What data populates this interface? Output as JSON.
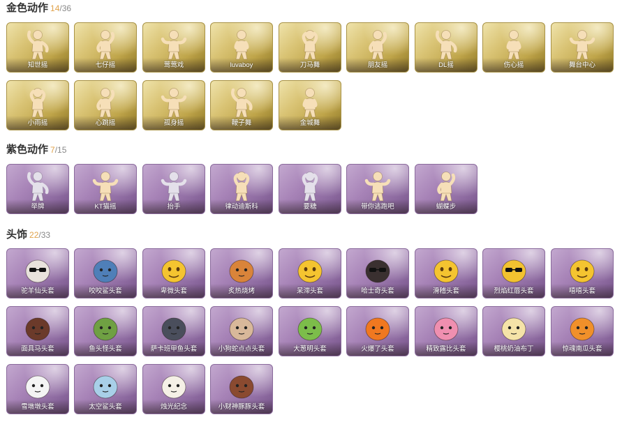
{
  "sections": [
    {
      "title": "金色动作",
      "count": "14",
      "total": "/36",
      "rarity": "gold",
      "items": [
        {
          "label": "知世摇",
          "icon": "dance-pose-icon"
        },
        {
          "label": "七仔摇",
          "icon": "dance-pose-icon"
        },
        {
          "label": "莺莺戏",
          "icon": "dance-pose-icon"
        },
        {
          "label": "luvaboy",
          "icon": "dance-pose-icon"
        },
        {
          "label": "刀马舞",
          "icon": "dance-pose-icon"
        },
        {
          "label": "朋友摇",
          "icon": "dance-pose-icon"
        },
        {
          "label": "DL摇",
          "icon": "dance-pose-icon"
        },
        {
          "label": "伤心摇",
          "icon": "dance-pose-icon"
        },
        {
          "label": "舞台中心",
          "icon": "dance-pose-icon"
        },
        {
          "label": "小雨摇",
          "icon": "dance-pose-icon"
        },
        {
          "label": "心跳摇",
          "icon": "dance-pose-icon"
        },
        {
          "label": "孤身摇",
          "icon": "dance-pose-icon"
        },
        {
          "label": "鞭子舞",
          "icon": "dance-pose-icon"
        },
        {
          "label": "金城舞",
          "icon": "dance-pose-icon"
        }
      ]
    },
    {
      "title": "紫色动作",
      "count": "7",
      "total": "/15",
      "rarity": "purple",
      "items": [
        {
          "label": "举牌",
          "icon": "holding-sign-icon"
        },
        {
          "label": "KT猫摇",
          "icon": "dance-pose-icon"
        },
        {
          "label": "抬手",
          "icon": "raise-hand-icon"
        },
        {
          "label": "律动迪斯科",
          "icon": "dance-pose-icon"
        },
        {
          "label": "要糖",
          "icon": "standing-pose-icon"
        },
        {
          "label": "带你逃跑吧",
          "icon": "dance-pose-icon"
        },
        {
          "label": "蝴蝶步",
          "icon": "dance-pose-icon"
        }
      ]
    },
    {
      "title": "头饰",
      "count": "22",
      "total": "/33",
      "rarity": "purple",
      "items": [
        {
          "label": "驼羊仙头套",
          "icon": "sunglasses-bear-head-icon",
          "color": "#e8e2dc"
        },
        {
          "label": "咬咬鲨头套",
          "icon": "shark-head-icon",
          "color": "#4f7fb8"
        },
        {
          "label": "卑微头套",
          "icon": "shy-emoji-head-icon",
          "color": "#f4c430"
        },
        {
          "label": "炙热烧烤",
          "icon": "toast-head-icon",
          "color": "#d9843a"
        },
        {
          "label": "呆滞头套",
          "icon": "dazed-emoji-head-icon",
          "color": "#f4c430"
        },
        {
          "label": "哈士奇头套",
          "icon": "husky-head-icon",
          "color": "#3a3030"
        },
        {
          "label": "滑稽头套",
          "icon": "grin-emoji-head-icon",
          "color": "#f4c430"
        },
        {
          "label": "烈焰红唇头套",
          "icon": "pikachu-head-icon",
          "color": "#f2c230"
        },
        {
          "label": "嘻嘻头套",
          "icon": "grin-teeth-emoji-head-icon",
          "color": "#f4c430"
        },
        {
          "label": "面具马头套",
          "icon": "horse-head-icon",
          "color": "#6b3a2a"
        },
        {
          "label": "鱼头怪头套",
          "icon": "fish-monster-head-icon",
          "color": "#6fa043"
        },
        {
          "label": "萨卡班甲鱼头套",
          "icon": "fish-head-icon",
          "color": "#4a4e5c"
        },
        {
          "label": "小狗蛇点点头套",
          "icon": "snake-head-icon",
          "color": "#d8b89a"
        },
        {
          "label": "大葱明头套",
          "icon": "scallion-head-icon",
          "color": "#7cbd4a"
        },
        {
          "label": "火爆了头套",
          "icon": "fire-head-icon",
          "color": "#f07820"
        },
        {
          "label": "精致露比头套",
          "icon": "pink-pig-head-icon",
          "color": "#ef8fb0"
        },
        {
          "label": "樱桃奶油布丁",
          "icon": "pudding-head-icon",
          "color": "#f5e3a8"
        },
        {
          "label": "惊魂南瓜头套",
          "icon": "pumpkin-head-icon",
          "color": "#f0902a"
        },
        {
          "label": "雪墩墩头套",
          "icon": "snowman-head-icon",
          "color": "#f4f4f4"
        },
        {
          "label": "太空鲨头套",
          "icon": "space-shark-head-icon",
          "color": "#a8cfe8"
        },
        {
          "label": "烛光纪念",
          "icon": "candle-head-icon",
          "color": "#f5f0e6"
        },
        {
          "label": "小财神豚豚头套",
          "icon": "fortune-pig-head-icon",
          "color": "#8a4a30"
        }
      ]
    }
  ]
}
